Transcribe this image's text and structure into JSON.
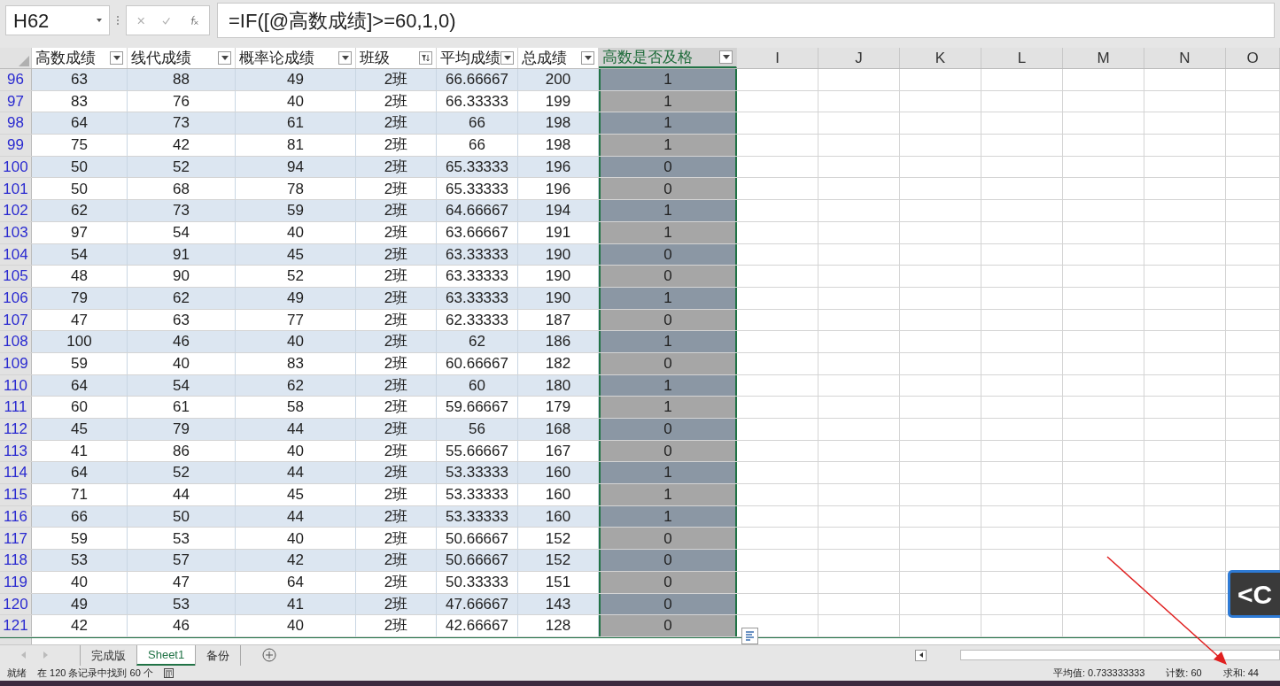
{
  "name_box": "H62",
  "formula": "=IF([@高数成绩]>=60,1,0)",
  "columns": [
    {
      "label": "高数成绩",
      "filtered": false
    },
    {
      "label": "线代成绩",
      "filtered": false
    },
    {
      "label": "概率论成绩",
      "filtered": false
    },
    {
      "label": "班级",
      "filtered": true
    },
    {
      "label": "平均成绩",
      "filtered": false
    },
    {
      "label": "总成绩",
      "filtered": false
    },
    {
      "label": "高数是否及格",
      "filtered": false,
      "selected": true
    }
  ],
  "empty_columns": [
    "I",
    "J",
    "K",
    "L",
    "M",
    "N",
    "O"
  ],
  "rows": [
    {
      "row": "96",
      "cells": [
        "63",
        "88",
        "49",
        "2班",
        "66.66667",
        "200",
        "1"
      ]
    },
    {
      "row": "97",
      "cells": [
        "83",
        "76",
        "40",
        "2班",
        "66.33333",
        "199",
        "1"
      ]
    },
    {
      "row": "98",
      "cells": [
        "64",
        "73",
        "61",
        "2班",
        "66",
        "198",
        "1"
      ]
    },
    {
      "row": "99",
      "cells": [
        "75",
        "42",
        "81",
        "2班",
        "66",
        "198",
        "1"
      ]
    },
    {
      "row": "100",
      "cells": [
        "50",
        "52",
        "94",
        "2班",
        "65.33333",
        "196",
        "0"
      ]
    },
    {
      "row": "101",
      "cells": [
        "50",
        "68",
        "78",
        "2班",
        "65.33333",
        "196",
        "0"
      ]
    },
    {
      "row": "102",
      "cells": [
        "62",
        "73",
        "59",
        "2班",
        "64.66667",
        "194",
        "1"
      ]
    },
    {
      "row": "103",
      "cells": [
        "97",
        "54",
        "40",
        "2班",
        "63.66667",
        "191",
        "1"
      ]
    },
    {
      "row": "104",
      "cells": [
        "54",
        "91",
        "45",
        "2班",
        "63.33333",
        "190",
        "0"
      ]
    },
    {
      "row": "105",
      "cells": [
        "48",
        "90",
        "52",
        "2班",
        "63.33333",
        "190",
        "0"
      ]
    },
    {
      "row": "106",
      "cells": [
        "79",
        "62",
        "49",
        "2班",
        "63.33333",
        "190",
        "1"
      ]
    },
    {
      "row": "107",
      "cells": [
        "47",
        "63",
        "77",
        "2班",
        "62.33333",
        "187",
        "0"
      ]
    },
    {
      "row": "108",
      "cells": [
        "100",
        "46",
        "40",
        "2班",
        "62",
        "186",
        "1"
      ]
    },
    {
      "row": "109",
      "cells": [
        "59",
        "40",
        "83",
        "2班",
        "60.66667",
        "182",
        "0"
      ]
    },
    {
      "row": "110",
      "cells": [
        "64",
        "54",
        "62",
        "2班",
        "60",
        "180",
        "1"
      ]
    },
    {
      "row": "111",
      "cells": [
        "60",
        "61",
        "58",
        "2班",
        "59.66667",
        "179",
        "1"
      ]
    },
    {
      "row": "112",
      "cells": [
        "45",
        "79",
        "44",
        "2班",
        "56",
        "168",
        "0"
      ]
    },
    {
      "row": "113",
      "cells": [
        "41",
        "86",
        "40",
        "2班",
        "55.66667",
        "167",
        "0"
      ]
    },
    {
      "row": "114",
      "cells": [
        "64",
        "52",
        "44",
        "2班",
        "53.33333",
        "160",
        "1"
      ]
    },
    {
      "row": "115",
      "cells": [
        "71",
        "44",
        "45",
        "2班",
        "53.33333",
        "160",
        "1"
      ]
    },
    {
      "row": "116",
      "cells": [
        "66",
        "50",
        "44",
        "2班",
        "53.33333",
        "160",
        "1"
      ]
    },
    {
      "row": "117",
      "cells": [
        "59",
        "53",
        "40",
        "2班",
        "50.66667",
        "152",
        "0"
      ]
    },
    {
      "row": "118",
      "cells": [
        "53",
        "57",
        "42",
        "2班",
        "50.66667",
        "152",
        "0"
      ]
    },
    {
      "row": "119",
      "cells": [
        "40",
        "47",
        "64",
        "2班",
        "50.33333",
        "151",
        "0"
      ]
    },
    {
      "row": "120",
      "cells": [
        "49",
        "53",
        "41",
        "2班",
        "47.66667",
        "143",
        "0"
      ]
    },
    {
      "row": "121",
      "cells": [
        "42",
        "46",
        "40",
        "2班",
        "42.66667",
        "128",
        "0"
      ]
    }
  ],
  "sheet_tabs": [
    {
      "label": "完成版",
      "selected": false
    },
    {
      "label": "Sheet1",
      "selected": true
    },
    {
      "label": "备份",
      "selected": false
    }
  ],
  "status_bar": {
    "mode": "就绪",
    "filter_info": "在 120 条记录中找到 60 个",
    "average": "平均值: 0.733333333",
    "count": "计数: 60",
    "sum": "求和: 44"
  },
  "key_overlay": "<C"
}
